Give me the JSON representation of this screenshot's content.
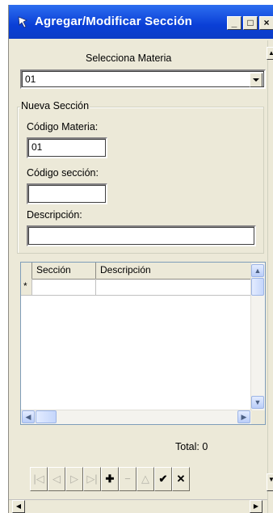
{
  "window": {
    "title": "Agregar/Modificar Sección",
    "minimize_label": "_",
    "restore_label": "□",
    "close_label": "×"
  },
  "materia": {
    "label": "Selecciona Materia",
    "selected": "01"
  },
  "nueva_seccion": {
    "group_title": "Nueva Sección",
    "codigo_materia_label": "Código Materia:",
    "codigo_materia_value": "01",
    "codigo_seccion_label": "Código sección:",
    "codigo_seccion_value": "",
    "descripcion_label": "Descripción:",
    "descripcion_value": ""
  },
  "grid": {
    "columns": [
      "Sección",
      "Descripción"
    ],
    "new_row_marker": "*"
  },
  "footer": {
    "total_label": "Total: 0"
  },
  "navigator": {
    "buttons": [
      {
        "name": "first",
        "glyph": "|◁"
      },
      {
        "name": "prior",
        "glyph": "◁"
      },
      {
        "name": "next",
        "glyph": "▷"
      },
      {
        "name": "last",
        "glyph": "▷|"
      },
      {
        "name": "insert",
        "glyph": "✚"
      },
      {
        "name": "delete",
        "glyph": "−"
      },
      {
        "name": "edit",
        "glyph": "△"
      },
      {
        "name": "post",
        "glyph": "✔"
      },
      {
        "name": "cancel",
        "glyph": "✕"
      }
    ]
  },
  "colors": {
    "title_bar": "#0a3fd6",
    "window_face": "#ece9d8"
  }
}
